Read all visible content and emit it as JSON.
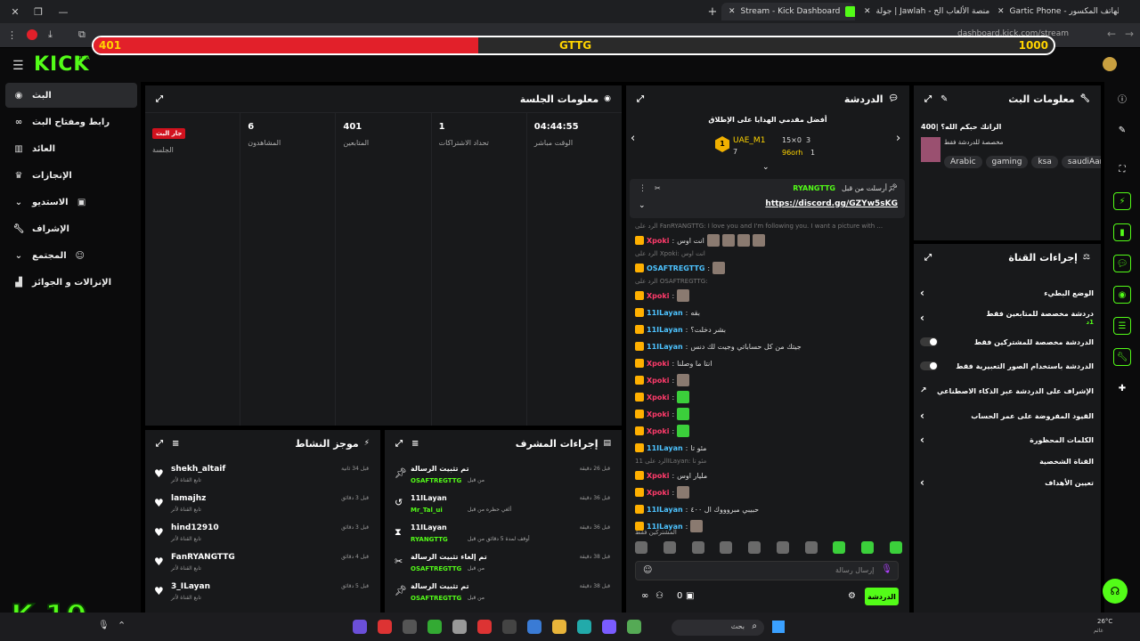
{
  "browser": {
    "tabs": [
      {
        "label": "Stream - Kick Dashboard",
        "active": true
      },
      {
        "label": "جولة | Jawlah - منصة الألعاب الح"
      },
      {
        "label": "Gartic Phone - الهاتف المكسور"
      }
    ],
    "url": "dashboard.kick.com/stream",
    "new_tab_icon": "plus-icon"
  },
  "overlay_bar": {
    "left_value": "401",
    "center_label": "GTTG",
    "right_value": "1000",
    "progress_fraction": 0.401,
    "fill_color": "#e2202a",
    "text_color": "#ffd400"
  },
  "brand": {
    "logo_text": "KICK",
    "beta": "BETA",
    "accent": "#53fc18"
  },
  "sidebar": {
    "items": [
      {
        "label": "البث",
        "icon": "broadcast-icon",
        "active": true
      },
      {
        "label": "رابط ومفتاح البث",
        "icon": "link-icon"
      },
      {
        "label": "العائد",
        "icon": "chart-icon"
      },
      {
        "label": "الإنجازات",
        "icon": "trophy-icon"
      },
      {
        "label": "الاستديو",
        "icon": "studio-icon"
      },
      {
        "label": "الإشراف",
        "icon": "wrench-icon"
      },
      {
        "label": "المجتمع",
        "icon": "users-icon"
      },
      {
        "label": "الإنزالات و الجوائز",
        "icon": "gift-icon"
      }
    ]
  },
  "session": {
    "title": "معلومات الجلسة",
    "stats": [
      {
        "value": "04:44:55",
        "label": "الوقت مباشر"
      },
      {
        "value": "1",
        "label": "تحداد الاشتراكات"
      },
      {
        "value": "401",
        "label": "المتابعين"
      },
      {
        "value": "6",
        "label": "المشاهدون"
      },
      {
        "value": "جار البث",
        "label": "الجلسة",
        "live": true
      }
    ]
  },
  "chat": {
    "title": "الدردشة",
    "leaderboard_title": "أفضل مقدمي الهدايا على الإطلاق",
    "leader1": {
      "name": "UAE_M1",
      "count": "7"
    },
    "leader2": {
      "name": "96orh",
      "count": "1"
    },
    "leader_stats": "15×0",
    "leader_rank3": "3",
    "pinned_by": "أرسلت من قبل",
    "pinned_user": "RYANGTTG",
    "pinned_link": "https://discord.gg/GZYw5sKG",
    "messages": [
      {
        "reply": "الرد على FanRYANGTTG: I love you and I'm following you. I want a picture with ...",
        "user": "Xpoki",
        "color": "pink",
        "text": "انت اوس",
        "emotes": 4
      },
      {
        "reply": "الرد على Xpoki: انت اوس",
        "user": "OSAFTREGTTG",
        "color": "blue",
        "text": "",
        "emotes": 1
      },
      {
        "reply": "الرد على OSAFTREGTTG:",
        "user": "Xpoki",
        "color": "pink",
        "text": "",
        "emotes": 1
      },
      {
        "user": "11ILayan",
        "color": "blue",
        "text": "بقه"
      },
      {
        "user": "11ILayan",
        "color": "blue",
        "text": "بشر دخلت؟"
      },
      {
        "user": "11ILayan",
        "color": "blue",
        "text": "جيتك من كل حساباتي وجيت لك دنس"
      },
      {
        "user": "Xpoki",
        "color": "pink",
        "text": "انتا ما وصلنا"
      },
      {
        "user": "Xpoki",
        "color": "pink",
        "text": "",
        "emotes": 1
      },
      {
        "user": "Xpoki",
        "color": "pink",
        "text": "",
        "emotes": 1,
        "green": true
      },
      {
        "user": "Xpoki",
        "color": "pink",
        "text": "",
        "emotes": 1,
        "green": true
      },
      {
        "user": "Xpoki",
        "color": "pink",
        "text": "",
        "emotes": 1,
        "green": true
      },
      {
        "user": "11ILayan",
        "color": "blue",
        "text": "مئو تا"
      },
      {
        "reply": "الرد على 11ILayan: مئو تا",
        "user": "Xpoki",
        "color": "pink",
        "text": "مليار اوس",
        "emotes": 0
      },
      {
        "user": "Xpoki",
        "color": "pink",
        "text": "",
        "emotes": 1
      },
      {
        "user": "11ILayan",
        "color": "blue",
        "text": "حبيبي مبروووك ال ٤٠٠"
      },
      {
        "user": "11ILayan",
        "color": "blue",
        "text": "",
        "emotes": 1
      }
    ],
    "emote_bar_label": "المشتركين فقط",
    "input_placeholder": "إرسال رسالة",
    "send_label": "الدردشة",
    "viewer_count": "0"
  },
  "activity": {
    "title": "موجز النشاط",
    "items": [
      {
        "user": "shekh_altaif",
        "sub": "تابع القناة لأتر",
        "time": "قبل 34 ثانية"
      },
      {
        "user": "lamajhz",
        "sub": "تابع القناة لأتر",
        "time": "قبل 3 دقائق"
      },
      {
        "user": "hind12910",
        "sub": "تابع القناة لأتر",
        "time": "قبل 3 دقائق"
      },
      {
        "user": "FanRYANGTTG",
        "sub": "تابع القناة لأتر",
        "time": "قبل 4 دقائق"
      },
      {
        "user": "3_ILayan",
        "sub": "تابع القناة لأتر",
        "time": "قبل 5 دقائق"
      }
    ]
  },
  "modactions": {
    "title": "إجراءات المشرف",
    "items": [
      {
        "action": "تم تثبيت الرسالة",
        "by": "OSAFTREGTTG",
        "prefix": "من قبل",
        "time": "قبل 26 دقيقة",
        "icon": "pin-icon"
      },
      {
        "action": "11ILayan",
        "by": "Mr_Tal_ui",
        "prefix": "ألغي حظره من قبل",
        "time": "قبل 36 دقيقة",
        "icon": "undo-icon"
      },
      {
        "action": "11ILayan",
        "by": "RYANGTTG",
        "prefix": "أوقف لمدة 5 دقائق من قبل",
        "time": "قبل 36 دقيقة",
        "icon": "timer-icon"
      },
      {
        "action": "تم إلغاء تثبيت الرسالة",
        "by": "OSAFTREGTTG",
        "prefix": "من قبل",
        "time": "قبل 38 دقيقة",
        "icon": "unpin-icon"
      },
      {
        "action": "تم تثبيت الرسالة",
        "by": "OSAFTREGTTG",
        "prefix": "من قبل",
        "time": "قبل 38 دقيقة",
        "icon": "pin-icon"
      }
    ]
  },
  "streaminfo": {
    "title": "معلومات البث",
    "stream_title": "400| الراتك حبكم الله؟",
    "subtitle": "مخصصة للدردشة فقط",
    "tags": [
      "Arabic",
      "gaming",
      "ksa",
      "saudiAarbi"
    ]
  },
  "channelactions": {
    "title": "إجراءات القناة",
    "rows": [
      {
        "label": "الوضع البطيء",
        "kind": "chevron"
      },
      {
        "label": "دردشة مخصصة للمتابعين فقط",
        "sub": "1د",
        "kind": "chevron"
      },
      {
        "label": "الدردشة مخصصة للمشتركين فقط",
        "kind": "toggle"
      },
      {
        "label": "الدردشة باستخدام الصور التعبيرية فقط",
        "kind": "toggle"
      },
      {
        "label": "الإشراف على الدردشة عبر الذكاء الاصطناعي",
        "kind": "external"
      },
      {
        "label": "القيود المفروضة على عمر الحساب",
        "kind": "chevron"
      },
      {
        "label": "الكلمات المحظورة",
        "kind": "chevron"
      },
      {
        "label": "القناة الشخصية",
        "kind": "heading"
      },
      {
        "label": "تعيين الأهداف",
        "kind": "chevron"
      }
    ]
  },
  "overlay_counter": {
    "letter": "K",
    "number": "10"
  },
  "taskbar": {
    "search_placeholder": "بحث",
    "weather": "26°C",
    "weather_sub": "غائم"
  }
}
